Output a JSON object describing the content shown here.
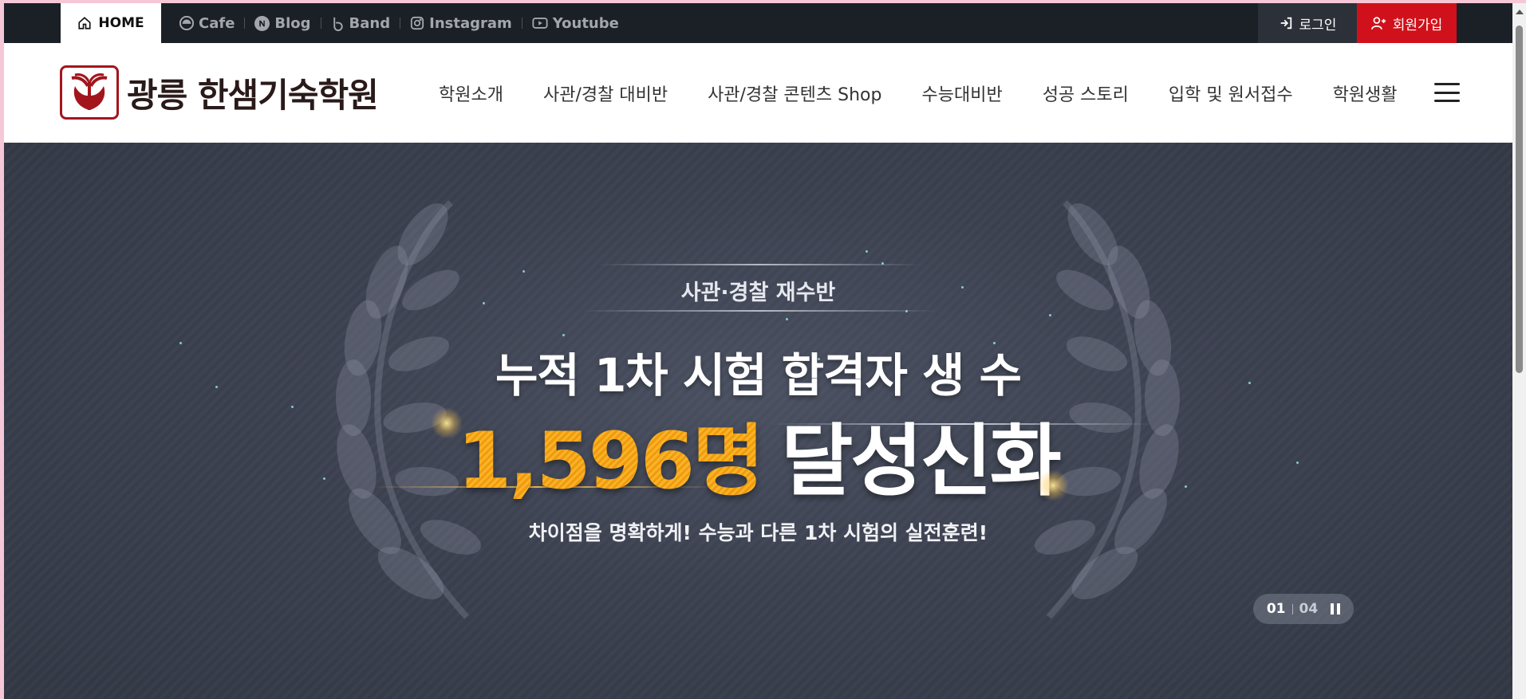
{
  "topbar": {
    "home_label": "HOME",
    "social": [
      {
        "label": "Cafe",
        "icon": "cafe-icon"
      },
      {
        "label": "Blog",
        "icon": "blog-icon"
      },
      {
        "label": "Band",
        "icon": "band-icon"
      },
      {
        "label": "Instagram",
        "icon": "instagram-icon"
      },
      {
        "label": "Youtube",
        "icon": "youtube-icon"
      }
    ],
    "login_label": "로그인",
    "join_label": "회원가입",
    "colors": {
      "bar": "#1b2027",
      "join": "#d0111b"
    }
  },
  "header": {
    "logo_text": "광릉 한샘기숙학원",
    "nav": [
      "학원소개",
      "사관/경찰 대비반",
      "사관/경찰 콘텐츠 Shop",
      "수능대비반",
      "성공 스토리",
      "입학 및 원서접수",
      "학원생활"
    ]
  },
  "hero": {
    "kicker": "사관·경찰 재수반",
    "headline": "누적 1차 시험 합격자 생 수",
    "number": "1,596명",
    "highlight": "달성신화",
    "sub": "차이점을 명확하게! 수능과 다른 1차 시험의 실전훈련!",
    "accent": "#f7a51a"
  },
  "pager": {
    "current": "01",
    "total": "04"
  }
}
